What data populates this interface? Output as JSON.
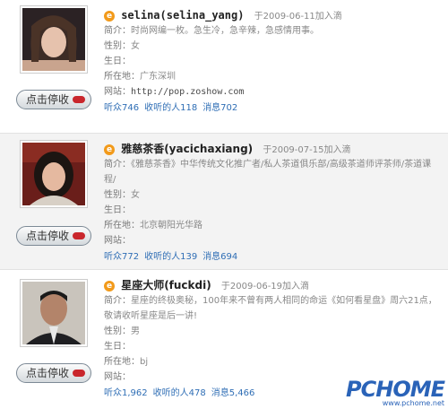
{
  "users": [
    {
      "name": "selina(selina_yang)",
      "joined": "于2009-06-11加入滴",
      "bio_label": "简介：",
      "bio": "时尚网编一枚。急生冷，急辛辣，急感情用事。",
      "gender_label": "性别：",
      "gender": "女",
      "birthday_label": "生日：",
      "birthday": "",
      "location_label": "所在地：",
      "location": "广东深圳",
      "website_label": "网站：",
      "website": "http://pop.zoshow.com",
      "listeners": "听众746",
      "listening": "收听的人118",
      "messages": "消息702",
      "unfollow": "点击停收"
    },
    {
      "name": "雅慈茶香(yacichaxiang)",
      "joined": "于2009-07-15加入滴",
      "bio_label": "简介：",
      "bio": "《雅慈茶香》中华传统文化推广者/私人茶道俱乐部/高级茶道师评茶师/茶道课程/",
      "gender_label": "性别：",
      "gender": "女",
      "birthday_label": "生日：",
      "birthday": "",
      "location_label": "所在地：",
      "location": "北京朝阳光华路",
      "website_label": "网站：",
      "website": "",
      "listeners": "听众772",
      "listening": "收听的人139",
      "messages": "消息694",
      "unfollow": "点击停收"
    },
    {
      "name": "星座大师(fuckdi)",
      "joined": "于2009-06-19加入滴",
      "bio_label": "简介：",
      "bio": "星座的终极奥秘，100年来不曾有两人相同的命运《如何看星盘》周六21点，敬请收听星座是后一讲!",
      "gender_label": "性别：",
      "gender": "男",
      "birthday_label": "生日：",
      "birthday": "",
      "location_label": "所在地：",
      "location": "bj",
      "website_label": "网站：",
      "website": "",
      "listeners": "听众1,962",
      "listening": "收听的人478",
      "messages": "消息5,466",
      "unfollow": "点击停收"
    }
  ],
  "badge_icon": "e-badge-icon",
  "watermark": {
    "logo": "PCHOME",
    "url": "www.pchome.net"
  }
}
